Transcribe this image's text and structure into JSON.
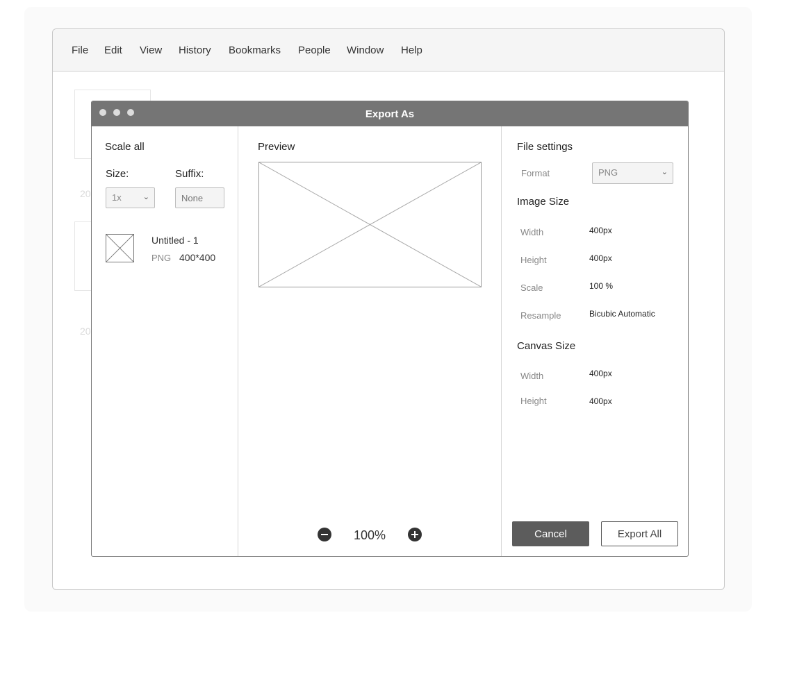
{
  "menu": {
    "items": [
      "File",
      "Edit",
      "View",
      "History",
      "Bookmarks",
      "People",
      "Window",
      "Help"
    ]
  },
  "background": {
    "label_1": "20",
    "label_2": "20"
  },
  "dialog": {
    "title": "Export As",
    "left": {
      "heading": "Scale all",
      "size_label": "Size:",
      "size_value": "1x",
      "suffix_label": "Suffix:",
      "suffix_placeholder": "None",
      "file": {
        "name": "Untitled - 1",
        "format": "PNG",
        "dimensions": "400*400"
      }
    },
    "preview": {
      "heading": "Preview",
      "zoom": "100%"
    },
    "settings": {
      "heading": "File settings",
      "format_label": "Format",
      "format_value": "PNG",
      "image_size": {
        "heading": "Image Size",
        "rows": [
          {
            "label": "Width",
            "value": "400px"
          },
          {
            "label": "Height",
            "value": "400px"
          },
          {
            "label": "Scale",
            "value": "100 %"
          },
          {
            "label": "Resample",
            "value": "Bicubic Automatic"
          }
        ]
      },
      "canvas_size": {
        "heading": "Canvas Size",
        "rows": [
          {
            "label": "Width",
            "value": "400px"
          },
          {
            "label": "Height",
            "value": "400px"
          }
        ]
      }
    },
    "buttons": {
      "cancel": "Cancel",
      "export_all": "Export All"
    }
  }
}
